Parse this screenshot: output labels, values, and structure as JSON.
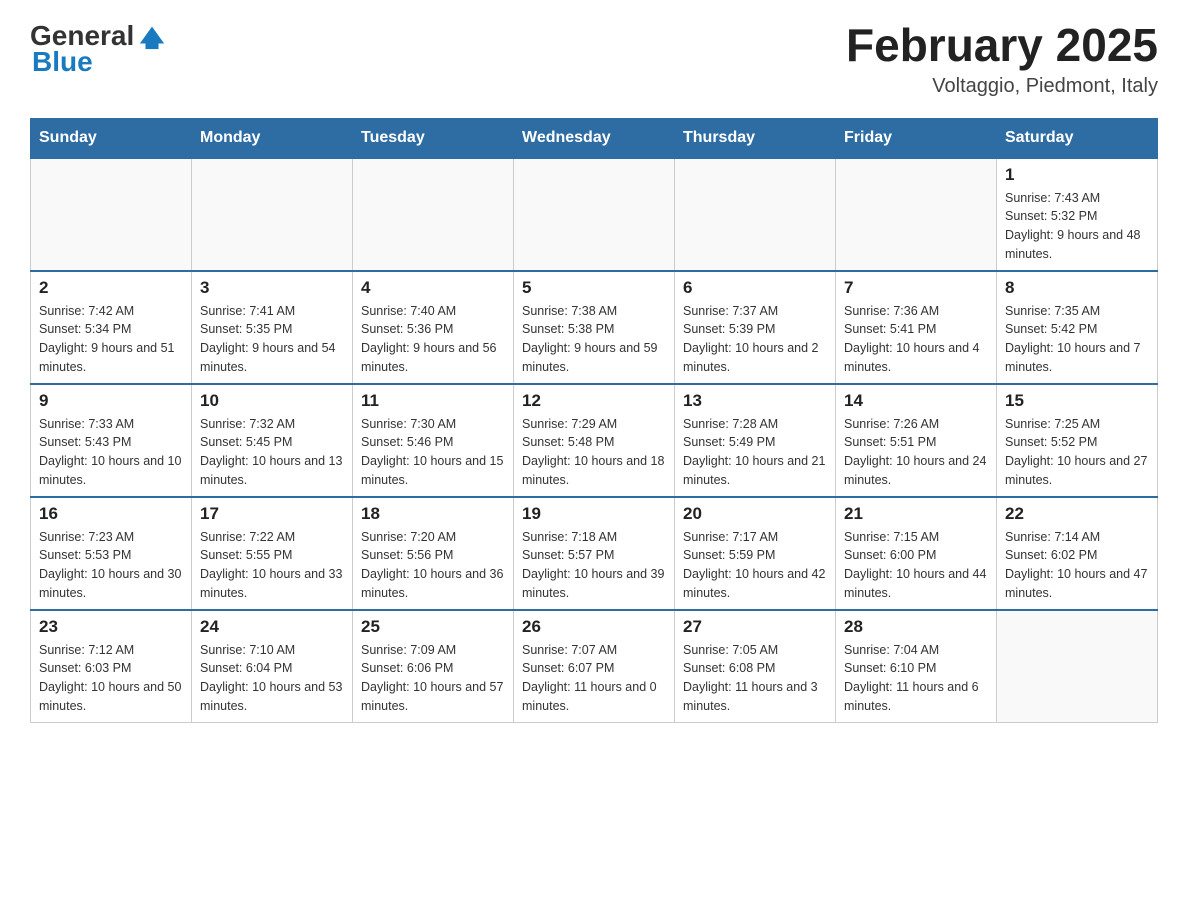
{
  "header": {
    "logo_text_general": "General",
    "logo_text_blue": "Blue",
    "month_title": "February 2025",
    "location": "Voltaggio, Piedmont, Italy"
  },
  "days_of_week": [
    "Sunday",
    "Monday",
    "Tuesday",
    "Wednesday",
    "Thursday",
    "Friday",
    "Saturday"
  ],
  "weeks": [
    [
      {
        "day": "",
        "info": ""
      },
      {
        "day": "",
        "info": ""
      },
      {
        "day": "",
        "info": ""
      },
      {
        "day": "",
        "info": ""
      },
      {
        "day": "",
        "info": ""
      },
      {
        "day": "",
        "info": ""
      },
      {
        "day": "1",
        "info": "Sunrise: 7:43 AM\nSunset: 5:32 PM\nDaylight: 9 hours and 48 minutes."
      }
    ],
    [
      {
        "day": "2",
        "info": "Sunrise: 7:42 AM\nSunset: 5:34 PM\nDaylight: 9 hours and 51 minutes."
      },
      {
        "day": "3",
        "info": "Sunrise: 7:41 AM\nSunset: 5:35 PM\nDaylight: 9 hours and 54 minutes."
      },
      {
        "day": "4",
        "info": "Sunrise: 7:40 AM\nSunset: 5:36 PM\nDaylight: 9 hours and 56 minutes."
      },
      {
        "day": "5",
        "info": "Sunrise: 7:38 AM\nSunset: 5:38 PM\nDaylight: 9 hours and 59 minutes."
      },
      {
        "day": "6",
        "info": "Sunrise: 7:37 AM\nSunset: 5:39 PM\nDaylight: 10 hours and 2 minutes."
      },
      {
        "day": "7",
        "info": "Sunrise: 7:36 AM\nSunset: 5:41 PM\nDaylight: 10 hours and 4 minutes."
      },
      {
        "day": "8",
        "info": "Sunrise: 7:35 AM\nSunset: 5:42 PM\nDaylight: 10 hours and 7 minutes."
      }
    ],
    [
      {
        "day": "9",
        "info": "Sunrise: 7:33 AM\nSunset: 5:43 PM\nDaylight: 10 hours and 10 minutes."
      },
      {
        "day": "10",
        "info": "Sunrise: 7:32 AM\nSunset: 5:45 PM\nDaylight: 10 hours and 13 minutes."
      },
      {
        "day": "11",
        "info": "Sunrise: 7:30 AM\nSunset: 5:46 PM\nDaylight: 10 hours and 15 minutes."
      },
      {
        "day": "12",
        "info": "Sunrise: 7:29 AM\nSunset: 5:48 PM\nDaylight: 10 hours and 18 minutes."
      },
      {
        "day": "13",
        "info": "Sunrise: 7:28 AM\nSunset: 5:49 PM\nDaylight: 10 hours and 21 minutes."
      },
      {
        "day": "14",
        "info": "Sunrise: 7:26 AM\nSunset: 5:51 PM\nDaylight: 10 hours and 24 minutes."
      },
      {
        "day": "15",
        "info": "Sunrise: 7:25 AM\nSunset: 5:52 PM\nDaylight: 10 hours and 27 minutes."
      }
    ],
    [
      {
        "day": "16",
        "info": "Sunrise: 7:23 AM\nSunset: 5:53 PM\nDaylight: 10 hours and 30 minutes."
      },
      {
        "day": "17",
        "info": "Sunrise: 7:22 AM\nSunset: 5:55 PM\nDaylight: 10 hours and 33 minutes."
      },
      {
        "day": "18",
        "info": "Sunrise: 7:20 AM\nSunset: 5:56 PM\nDaylight: 10 hours and 36 minutes."
      },
      {
        "day": "19",
        "info": "Sunrise: 7:18 AM\nSunset: 5:57 PM\nDaylight: 10 hours and 39 minutes."
      },
      {
        "day": "20",
        "info": "Sunrise: 7:17 AM\nSunset: 5:59 PM\nDaylight: 10 hours and 42 minutes."
      },
      {
        "day": "21",
        "info": "Sunrise: 7:15 AM\nSunset: 6:00 PM\nDaylight: 10 hours and 44 minutes."
      },
      {
        "day": "22",
        "info": "Sunrise: 7:14 AM\nSunset: 6:02 PM\nDaylight: 10 hours and 47 minutes."
      }
    ],
    [
      {
        "day": "23",
        "info": "Sunrise: 7:12 AM\nSunset: 6:03 PM\nDaylight: 10 hours and 50 minutes."
      },
      {
        "day": "24",
        "info": "Sunrise: 7:10 AM\nSunset: 6:04 PM\nDaylight: 10 hours and 53 minutes."
      },
      {
        "day": "25",
        "info": "Sunrise: 7:09 AM\nSunset: 6:06 PM\nDaylight: 10 hours and 57 minutes."
      },
      {
        "day": "26",
        "info": "Sunrise: 7:07 AM\nSunset: 6:07 PM\nDaylight: 11 hours and 0 minutes."
      },
      {
        "day": "27",
        "info": "Sunrise: 7:05 AM\nSunset: 6:08 PM\nDaylight: 11 hours and 3 minutes."
      },
      {
        "day": "28",
        "info": "Sunrise: 7:04 AM\nSunset: 6:10 PM\nDaylight: 11 hours and 6 minutes."
      },
      {
        "day": "",
        "info": ""
      }
    ]
  ]
}
